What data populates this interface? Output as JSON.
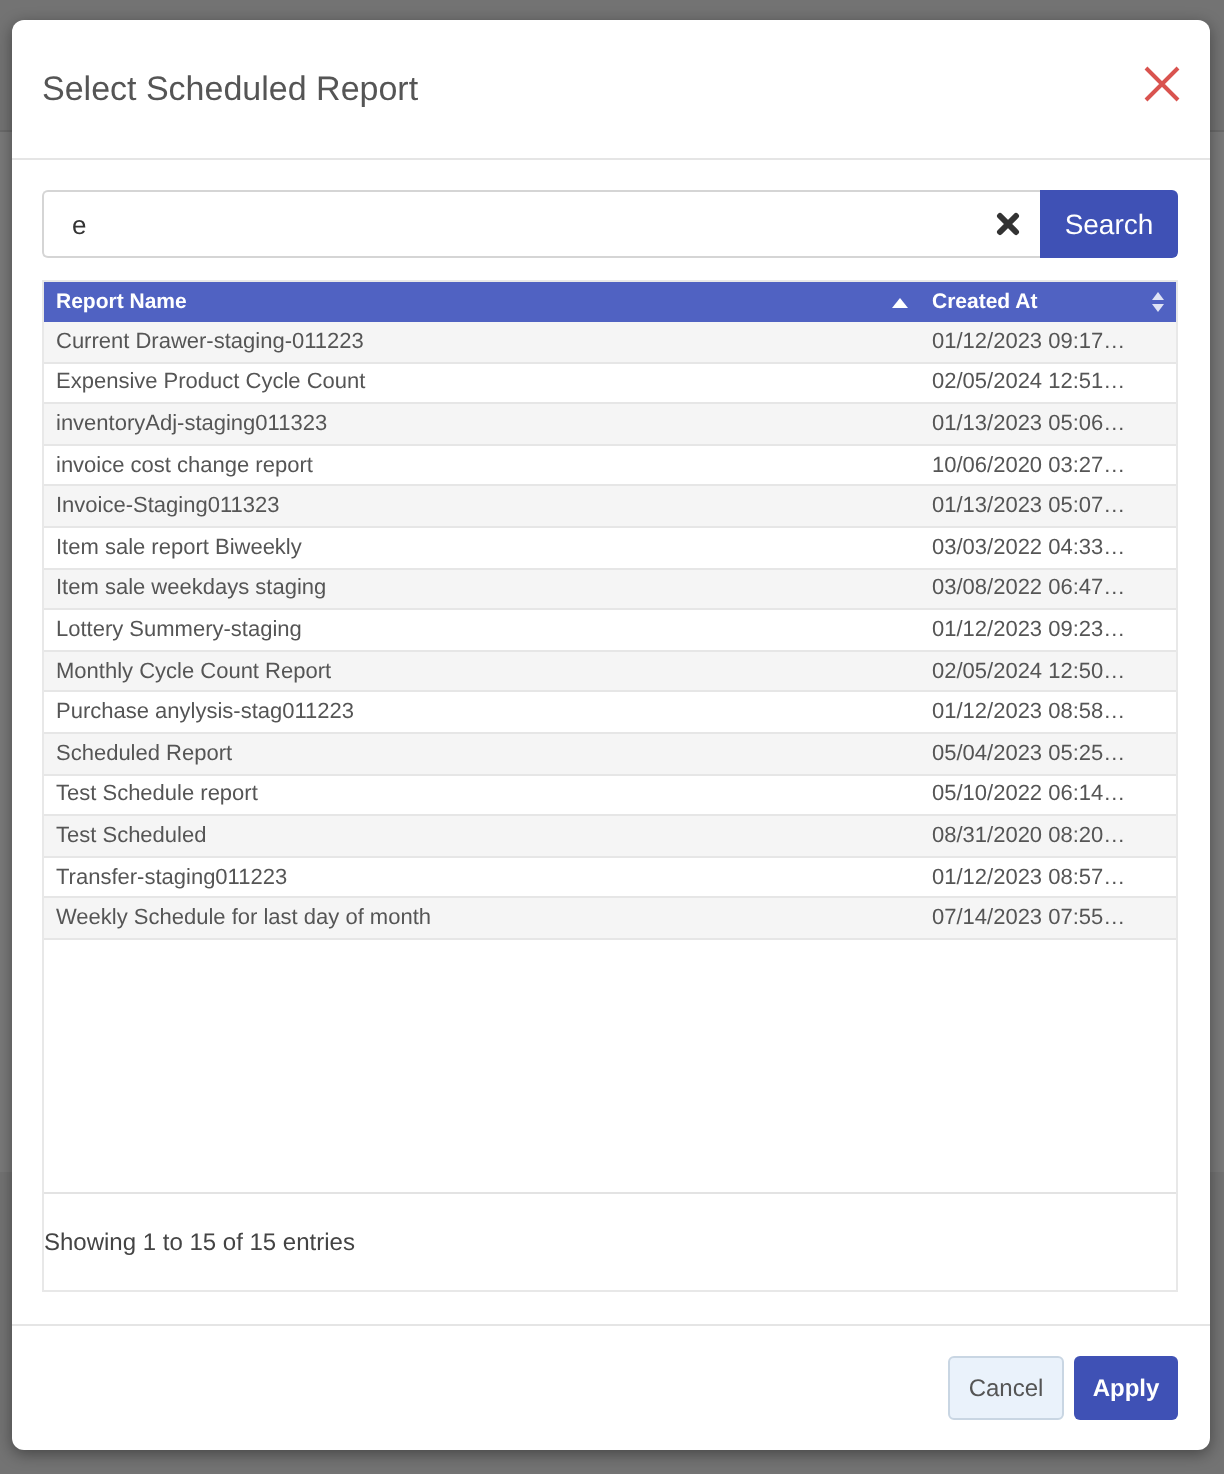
{
  "dialog": {
    "title": "Select Scheduled Report"
  },
  "search": {
    "value": "e",
    "button": "Search"
  },
  "table": {
    "columns": [
      {
        "label": "Report Name",
        "sorted": true
      },
      {
        "label": "Created At",
        "sorted": false
      }
    ],
    "rows": [
      [
        "Current Drawer-staging-011223",
        "01/12/2023 09:17…"
      ],
      [
        "Expensive Product Cycle Count",
        "02/05/2024 12:51…"
      ],
      [
        "inventoryAdj-staging011323",
        "01/13/2023 05:06…"
      ],
      [
        "invoice cost change report",
        "10/06/2020 03:27…"
      ],
      [
        "Invoice-Staging011323",
        "01/13/2023 05:07…"
      ],
      [
        "Item sale report Biweekly",
        "03/03/2022 04:33…"
      ],
      [
        "Item sale weekdays staging",
        "03/08/2022 06:47…"
      ],
      [
        "Lottery Summery-staging",
        "01/12/2023 09:23…"
      ],
      [
        "Monthly Cycle Count Report",
        "02/05/2024 12:50…"
      ],
      [
        "Purchase anylysis-stag011223",
        "01/12/2023 08:58…"
      ],
      [
        "Scheduled Report",
        "05/04/2023 05:25…"
      ],
      [
        "Test Schedule report",
        "05/10/2022 06:14…"
      ],
      [
        "Test Scheduled",
        "08/31/2020 08:20…"
      ],
      [
        "Transfer-staging011223",
        "01/12/2023 08:57…"
      ],
      [
        "Weekly Schedule for last day of month",
        "07/14/2023 07:55…"
      ]
    ],
    "info": "Showing 1 to 15 of 15 entries"
  },
  "buttons": [
    {
      "label": "Cancel",
      "kind": "secondary"
    },
    {
      "label": "Apply",
      "kind": "primary"
    }
  ]
}
